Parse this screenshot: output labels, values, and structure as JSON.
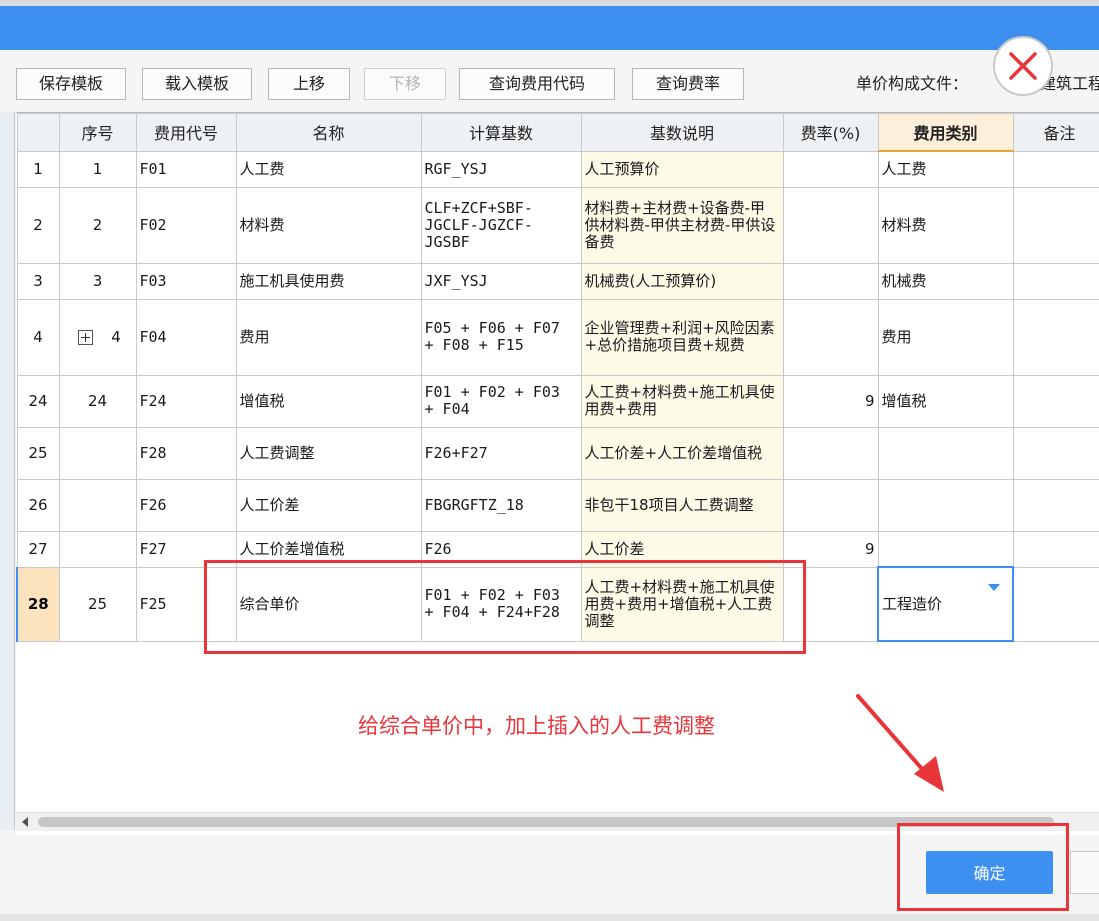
{
  "toolbar": {
    "save_template": "保存模板",
    "load_template": "载入模板",
    "move_up": "上移",
    "move_down": "下移",
    "query_fee_code": "查询费用代码",
    "query_rate": "查询费率",
    "file_label": "单价构成文件：",
    "file_value": "建筑工程"
  },
  "table": {
    "headers": {
      "seq": "序号",
      "code": "费用代号",
      "name": "名称",
      "base": "计算基数",
      "desc": "基数说明",
      "rate": "费率(%)",
      "category": "费用类别",
      "remark": "备注"
    },
    "rows": [
      {
        "rn": "1",
        "seq": "1",
        "code": "F01",
        "name": "人工费",
        "base": "RGF_YSJ",
        "desc": "人工预算价",
        "rate": "",
        "category": "人工费",
        "remark": ""
      },
      {
        "rn": "2",
        "seq": "2",
        "code": "F02",
        "name": "材料费",
        "base": "CLF+ZCF+SBF-JGCLF-JGZCF-JGSBF",
        "desc": "材料费+主材费+设备费-甲供材料费-甲供主材费-甲供设备费",
        "rate": "",
        "category": "材料费",
        "remark": ""
      },
      {
        "rn": "3",
        "seq": "3",
        "code": "F03",
        "name": "施工机具使用费",
        "base": "JXF_YSJ",
        "desc": "机械费(人工预算价)",
        "rate": "",
        "category": "机械费",
        "remark": ""
      },
      {
        "rn": "4",
        "seq": "4",
        "code": "F04",
        "name": "费用",
        "base": "F05 + F06 + F07 + F08 + F15",
        "desc": "企业管理费+利润+风险因素+总价措施项目费+规费",
        "rate": "",
        "category": "费用",
        "remark": ""
      },
      {
        "rn": "24",
        "seq": "24",
        "code": "F24",
        "name": "增值税",
        "base": "F01 + F02 + F03 + F04",
        "desc": "人工费+材料费+施工机具使用费+费用",
        "rate": "9",
        "category": "增值税",
        "remark": ""
      },
      {
        "rn": "25",
        "seq": "",
        "code": "F28",
        "name": "人工费调整",
        "base": "F26+F27",
        "desc": "人工价差+人工价差增值税",
        "rate": "",
        "category": "",
        "remark": ""
      },
      {
        "rn": "26",
        "seq": "",
        "code": "F26",
        "name": "人工价差",
        "base": "FBGRGFTZ_18",
        "desc": "非包干18项目人工费调整",
        "rate": "",
        "category": "",
        "remark": ""
      },
      {
        "rn": "27",
        "seq": "",
        "code": "F27",
        "name": "人工价差增值税",
        "base": "F26",
        "desc": "人工价差",
        "rate": "9",
        "category": "",
        "remark": ""
      },
      {
        "rn": "28",
        "seq": "25",
        "code": "F25",
        "name": "综合单价",
        "base": "F01 + F02 + F03 + F04 + F24+F28",
        "desc": "人工费+材料费+施工机具使用费+费用+增值税+人工费调整",
        "rate": "",
        "category": "工程造价",
        "remark": ""
      }
    ]
  },
  "annotation": "给综合单价中，加上插入的人工费调整",
  "confirm_label": "确定",
  "colors": {
    "accent": "#3d8ff0",
    "annotation_red": "#e8353a",
    "selected_row": "#fce3bd",
    "desc_column": "#fefae8"
  }
}
